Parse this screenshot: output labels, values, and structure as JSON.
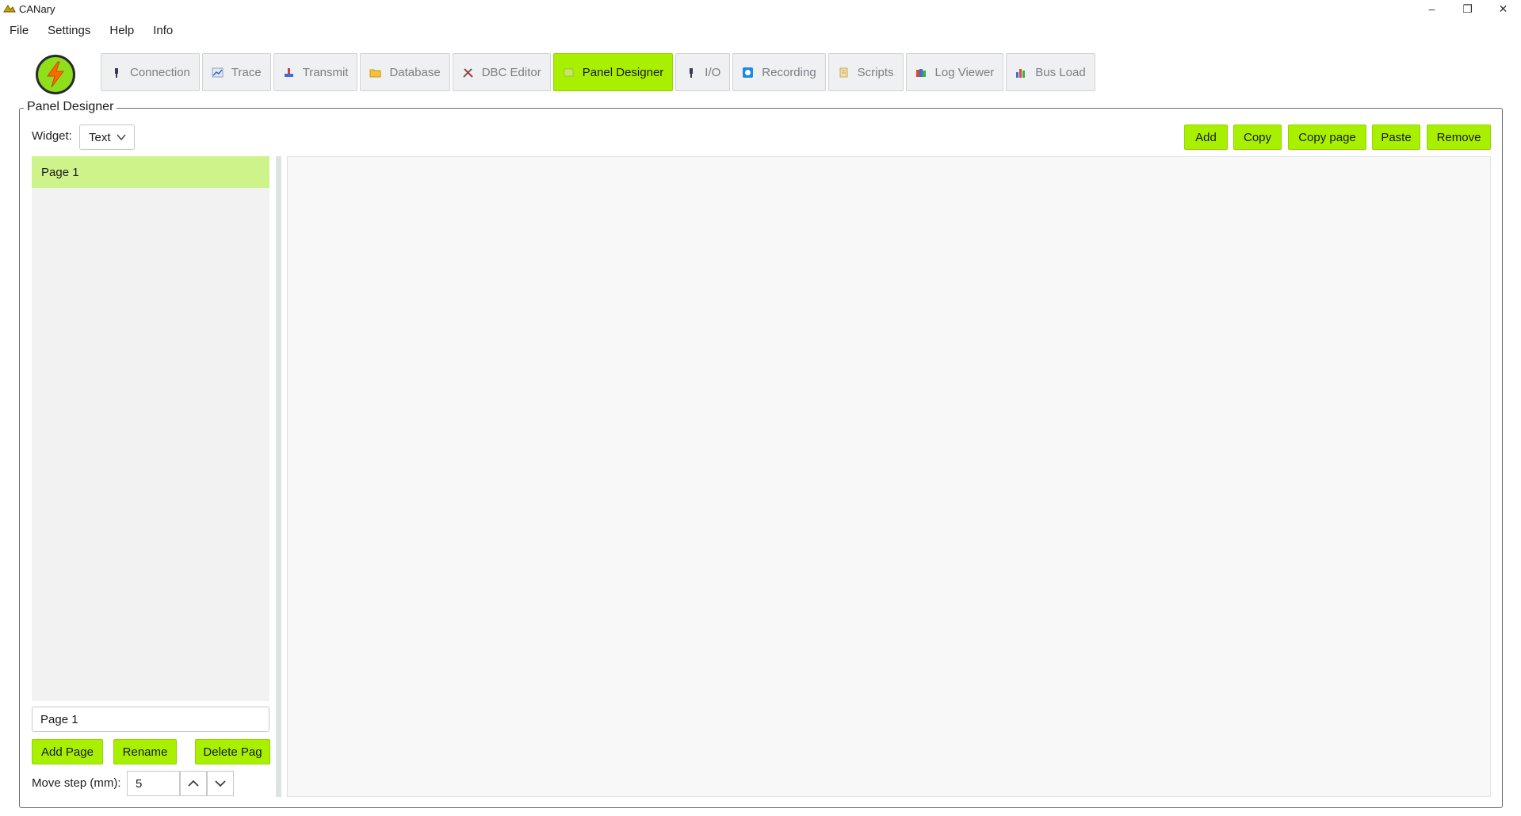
{
  "window": {
    "title": "CANary",
    "minimize_glyph": "–",
    "maximize_glyph": "❐",
    "close_glyph": "✕"
  },
  "menu": {
    "items": [
      {
        "label": "File"
      },
      {
        "label": "Settings"
      },
      {
        "label": "Help"
      },
      {
        "label": "Info"
      }
    ]
  },
  "toolbar": {
    "active_tab": "Panel Designer",
    "tabs": [
      {
        "label": "Connection",
        "icon": "plug-icon"
      },
      {
        "label": "Trace",
        "icon": "chart-line-icon"
      },
      {
        "label": "Transmit",
        "icon": "transmit-icon"
      },
      {
        "label": "Database",
        "icon": "folder-icon"
      },
      {
        "label": "DBC Editor",
        "icon": "tools-icon"
      },
      {
        "label": "Panel Designer",
        "icon": "panel-icon"
      },
      {
        "label": "I/O",
        "icon": "io-icon"
      },
      {
        "label": "Recording",
        "icon": "record-icon"
      },
      {
        "label": "Scripts",
        "icon": "scroll-icon"
      },
      {
        "label": "Log Viewer",
        "icon": "books-icon"
      },
      {
        "label": "Bus Load",
        "icon": "bar-chart-icon"
      }
    ]
  },
  "panel": {
    "group_title": "Panel Designer",
    "widget_label": "Widget:",
    "widget_value": "Text",
    "actions": {
      "add": "Add",
      "copy": "Copy",
      "copy_page": "Copy page",
      "paste": "Paste",
      "remove": "Remove"
    },
    "pages": [
      {
        "name": "Page 1",
        "selected": true
      }
    ],
    "page_name_value": "Page 1",
    "page_buttons": {
      "add_page": "Add Page",
      "rename": "Rename",
      "delete_page": "Delete Pag"
    },
    "move_step_label": "Move step (mm):",
    "move_step_value": "5"
  },
  "colors": {
    "accent": "#a8f000",
    "selected_row": "#cef38a"
  }
}
